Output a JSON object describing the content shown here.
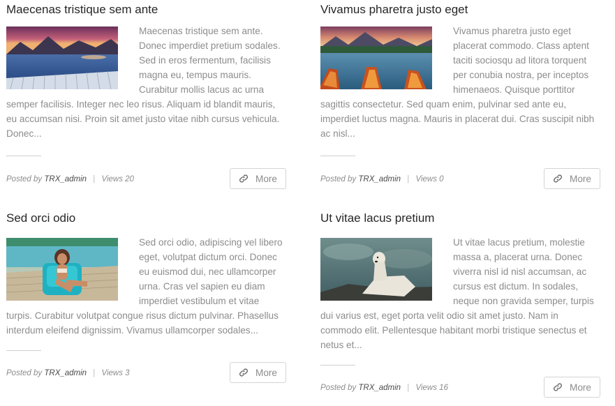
{
  "posts": [
    {
      "title": "Maecenas tristique sem ante",
      "image_icon": "mountain-lake-dock-image",
      "excerpt": "Maecenas tristique sem ante. Donec imperdiet pretium sodales. Sed in eros fermentum, facilisis magna eu, tempus mauris. Curabitur mollis lacus ac urna semper facilisis. Integer nec leo risus. Aliquam id blandit mauris, eu accumsan nisi. Proin sit amet justo vitae nibh cursus vehicula. Donec...",
      "posted_by_label": "Posted by",
      "author": "TRX_admin",
      "views_label": "Views 20",
      "more_label": "More"
    },
    {
      "title": "Vivamus pharetra justo eget",
      "image_icon": "lake-canoes-image",
      "excerpt": "Vivamus pharetra justo eget placerat commodo. Class aptent taciti sociosqu ad litora torquent per conubia nostra, per inceptos himenaeos. Quisque porttitor sagittis consectetur. Sed quam enim, pulvinar sed ante eu, imperdiet luctus magna. Mauris in placerat dui. Cras suscipit nibh ac nisl...",
      "posted_by_label": "Posted by",
      "author": "TRX_admin",
      "views_label": "Views 0",
      "more_label": "More"
    },
    {
      "title": "Sed orci odio",
      "image_icon": "woman-poolside-image",
      "excerpt": "Sed orci odio, adipiscing vel libero eget, volutpat dictum orci. Donec eu euismod dui, nec ullamcorper urna. Cras vel sapien eu diam imperdiet vestibulum et vitae turpis. Curabitur volutpat congue risus dictum pulvinar. Phasellus interdum eleifend dignissim. Vivamus ullamcorper sodales...",
      "posted_by_label": "Posted by",
      "author": "TRX_admin",
      "views_label": "Views 3",
      "more_label": "More"
    },
    {
      "title": "Ut vitae lacus pretium",
      "image_icon": "polar-bear-image",
      "excerpt": "Ut vitae lacus pretium, molestie massa a, placerat urna. Donec viverra nisl id nisl accumsan, ac cursus est dictum. In sodales, neque non gravida semper, turpis dui varius est, eget porta velit odio sit amet justo. Nam in commodo elit. Pellentesque habitant morbi tristique senectus et netus et...",
      "posted_by_label": "Posted by",
      "author": "TRX_admin",
      "views_label": "Views 16",
      "more_label": "More"
    }
  ],
  "colors": {
    "title": "#262626",
    "text": "#8c8c8c",
    "author": "#4a4a4a",
    "button_border": "#d4d4d4"
  }
}
